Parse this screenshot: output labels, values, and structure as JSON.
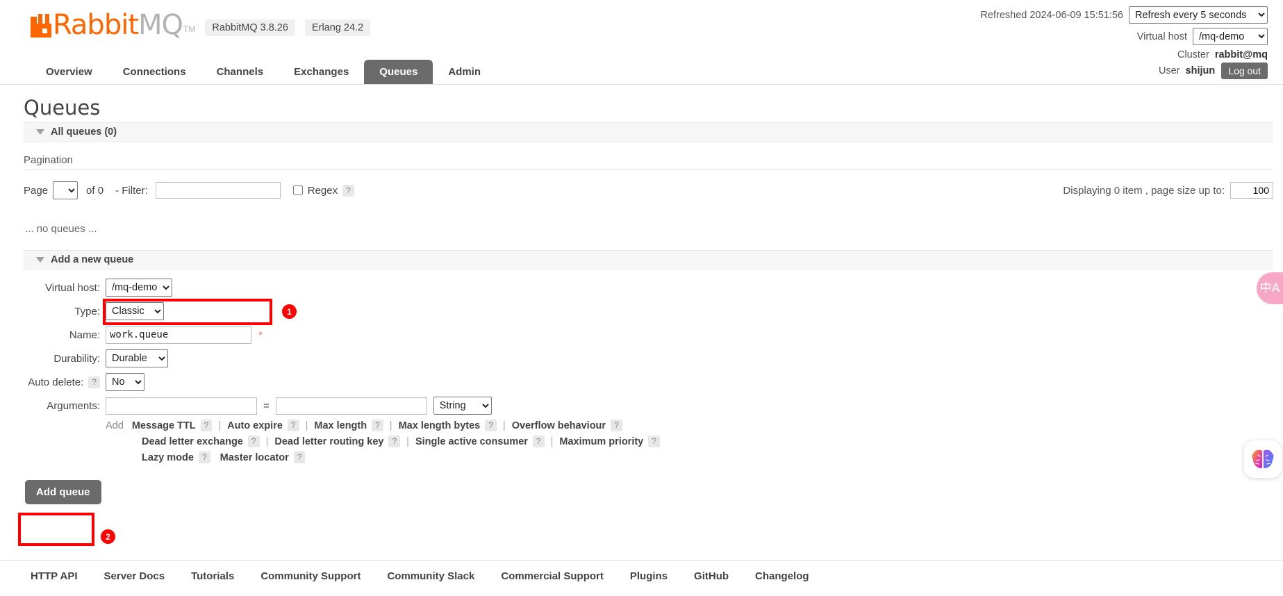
{
  "header": {
    "logo_rabbit": "Rabbit",
    "logo_mq": "MQ",
    "logo_tm": "TM",
    "version_badge": "RabbitMQ 3.8.26",
    "erlang_badge": "Erlang 24.2",
    "refreshed_label": "Refreshed 2024-06-09 15:51:56",
    "refresh_option": "Refresh every 5 seconds",
    "vhost_label": "Virtual host",
    "vhost_option": "/mq-demo",
    "cluster_label": "Cluster",
    "cluster_name": "rabbit@mq",
    "user_label": "User",
    "user_name": "shijun",
    "logout_label": "Log out"
  },
  "nav": {
    "tabs": [
      {
        "label": "Overview",
        "active": false
      },
      {
        "label": "Connections",
        "active": false
      },
      {
        "label": "Channels",
        "active": false
      },
      {
        "label": "Exchanges",
        "active": false
      },
      {
        "label": "Queues",
        "active": true
      },
      {
        "label": "Admin",
        "active": false
      }
    ]
  },
  "page": {
    "title": "Queues",
    "all_queues_label": "All queues (0)",
    "pagination_label": "Pagination",
    "page_label": "Page",
    "page_value": "",
    "of_label": "of 0",
    "filter_label": "- Filter:",
    "filter_value": "",
    "filter_placeholder": "",
    "regex_label": "Regex",
    "regex_help": "?",
    "displaying_label": "Displaying 0 item , page size up to:",
    "page_size_value": "100",
    "no_queues_text": "... no queues ..."
  },
  "add_queue": {
    "section_label": "Add a new queue",
    "vhost_label": "Virtual host:",
    "vhost_value": "/mq-demo",
    "type_label": "Type:",
    "type_value": "Classic",
    "name_label": "Name:",
    "name_value": "work.queue",
    "name_required_marker": "*",
    "durability_label": "Durability:",
    "durability_value": "Durable",
    "auto_delete_label": "Auto delete:",
    "auto_delete_help": "?",
    "auto_delete_value": "No",
    "arguments_label": "Arguments:",
    "arg_key_value": "",
    "arg_equals": "=",
    "arg_value_value": "",
    "arg_type_value": "String",
    "add_label": "Add",
    "arg_presets_row1": [
      {
        "label": "Message TTL",
        "help": "?"
      },
      {
        "label": "Auto expire",
        "help": "?"
      },
      {
        "label": "Max length",
        "help": "?"
      },
      {
        "label": "Max length bytes",
        "help": "?"
      },
      {
        "label": "Overflow behaviour",
        "help": "?"
      }
    ],
    "arg_presets_row2": [
      {
        "label": "Dead letter exchange",
        "help": "?"
      },
      {
        "label": "Dead letter routing key",
        "help": "?"
      },
      {
        "label": "Single active consumer",
        "help": "?"
      },
      {
        "label": "Maximum priority",
        "help": "?"
      }
    ],
    "arg_presets_row3": [
      {
        "label": "Lazy mode",
        "help": "?"
      },
      {
        "label": "Master locator",
        "help": "?"
      }
    ],
    "separator": "|",
    "submit_label": "Add queue"
  },
  "annotations": [
    {
      "number": "1"
    },
    {
      "number": "2"
    }
  ],
  "footer": {
    "links": [
      "HTTP API",
      "Server Docs",
      "Tutorials",
      "Community Support",
      "Community Slack",
      "Commercial Support",
      "Plugins",
      "GitHub",
      "Changelog"
    ]
  },
  "widgets": {
    "translate_glyph": "中A",
    "brain_label": "brain-icon"
  },
  "colors": {
    "brand_orange": "#ff6600",
    "active_tab": "#6b6b6b",
    "annotation_red": "#ff0000",
    "translate_pink": "#f7a8c4"
  }
}
